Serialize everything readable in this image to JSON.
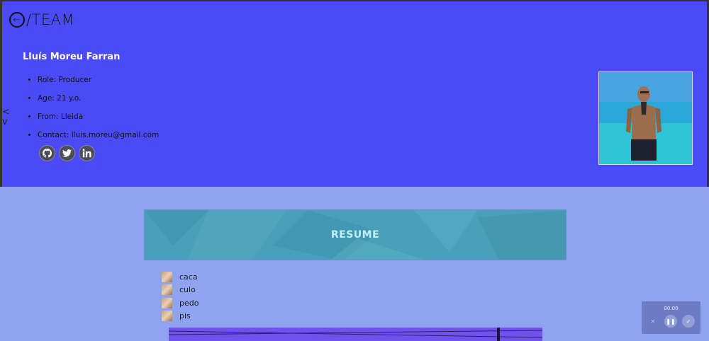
{
  "header": {
    "logo_text": "/TEAM",
    "back_glyph": "←"
  },
  "profile": {
    "name": "Lluís Moreu Farran",
    "info": [
      "Role: Producer",
      "Age: 21 y.o.",
      "From: Lleida",
      "Contact: lluis.moreu@gmail.com"
    ],
    "socials": [
      "github-icon",
      "twitter-icon",
      "linkedin-icon"
    ],
    "photo_alt": "profile-photo"
  },
  "side_marks": {
    "line1": "<",
    "line2": "v"
  },
  "resume": {
    "label": "RESUME"
  },
  "list": [
    {
      "label": "caca"
    },
    {
      "label": "culo"
    },
    {
      "label": "pedo"
    },
    {
      "label": "pis"
    }
  ],
  "player": {
    "time": "00:00"
  },
  "colors": {
    "header_bg": "#4a4bf6",
    "page_bg": "#8fa3f1",
    "resume_bg": "#4aa0b8"
  }
}
